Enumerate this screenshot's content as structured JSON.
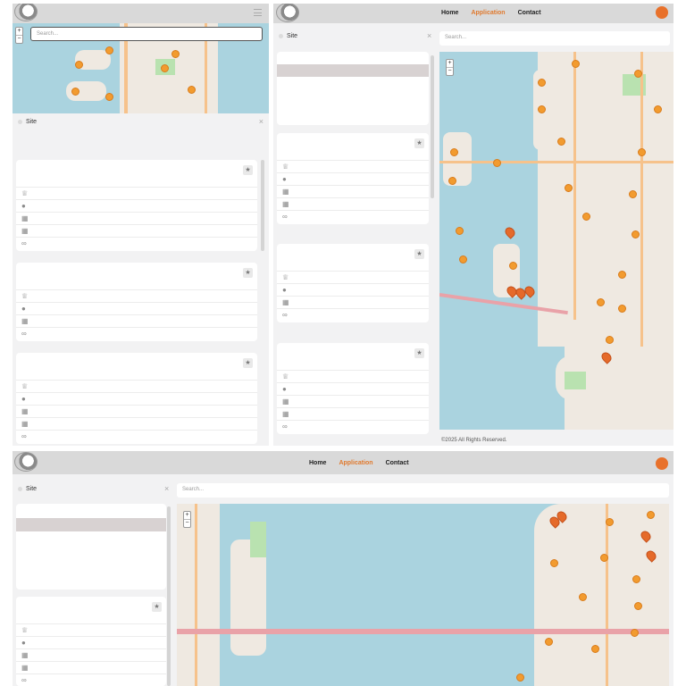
{
  "nav": {
    "home": "Home",
    "application": "Application",
    "contact": "Contact"
  },
  "search": {
    "placeholder": "Search..."
  },
  "site_panel": {
    "title": "Site",
    "close": "×"
  },
  "map": {
    "zoom_in": "+",
    "zoom_out": "−"
  },
  "footer": {
    "copyright": "©2025 All Rights Reserved."
  },
  "colors": {
    "accent": "#e07a2f",
    "avatar": "#e8712b",
    "water": "#aad3df",
    "marker": "#f29b2f",
    "topbar": "#d9d9d9"
  },
  "icons": [
    "menu-icon",
    "star-icon",
    "award-icon",
    "location-pin-icon",
    "calendar-icon",
    "link-icon",
    "close-icon"
  ]
}
